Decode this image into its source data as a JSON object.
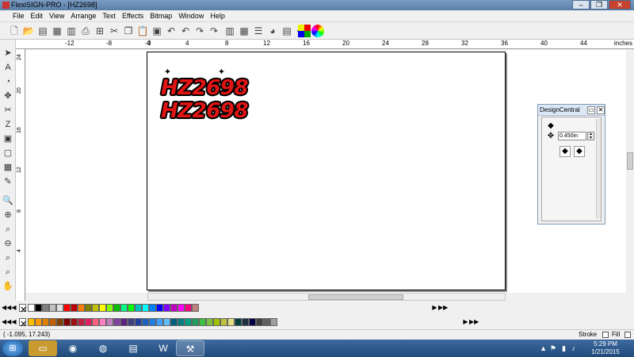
{
  "window": {
    "title": "FlexiSIGN-PRO - [HZ2698]",
    "buttons": [
      "–",
      "❐",
      "✕"
    ]
  },
  "menu": [
    "File",
    "Edit",
    "View",
    "Arrange",
    "Text",
    "Effects",
    "Bitmap",
    "Window",
    "Help"
  ],
  "ruler": {
    "h_labels": [
      "-12",
      "-8",
      "-4",
      "0",
      "4",
      "8",
      "12",
      "16",
      "20",
      "24",
      "28",
      "32",
      "36",
      "40",
      "44"
    ],
    "unit": "inches",
    "v_labels": [
      "24",
      "20",
      "16",
      "12",
      "8",
      "4"
    ]
  },
  "design": {
    "lines": [
      "HZ2698",
      "HZ2698"
    ]
  },
  "design_central": {
    "title": "DesignCentral",
    "value": "0.450in"
  },
  "statusbar": {
    "coords": "( -1.095,    17.243)",
    "stroke_label": "Stroke",
    "fill_label": "Fill"
  },
  "taskbar": {
    "time": "5:29 PM",
    "date": "1/21/2015"
  },
  "colors": {
    "design_fill": "#e01414",
    "palette1": [
      "#ffffff",
      "#000000",
      "#808080",
      "#c0c0c0",
      "#e0e0e0",
      "#ff0000",
      "#c00000",
      "#ff8000",
      "#808000",
      "#c0c000",
      "#ffff00",
      "#80ff00",
      "#00c000",
      "#00ff80",
      "#00ff00",
      "#00c0c0",
      "#00ffff",
      "#0080ff",
      "#0000ff",
      "#8000ff",
      "#c000c0",
      "#ff00ff",
      "#ff0080",
      "#c08080"
    ],
    "palette2": [
      "#ffc000",
      "#ff9900",
      "#e08000",
      "#c06000",
      "#804000",
      "#800000",
      "#a01010",
      "#c02040",
      "#e02060",
      "#ff6080",
      "#ff80c0",
      "#c080c0",
      "#8040a0",
      "#602080",
      "#404080",
      "#2040a0",
      "#2060c0",
      "#2080e0",
      "#40a0ff",
      "#60c0ff",
      "#006080",
      "#008080",
      "#00a080",
      "#20a060",
      "#40c040",
      "#80c040",
      "#a0c000",
      "#c0c040",
      "#e0e080",
      "#004040",
      "#203040",
      "#000040",
      "#404040",
      "#606060",
      "#a0a0a0"
    ]
  }
}
